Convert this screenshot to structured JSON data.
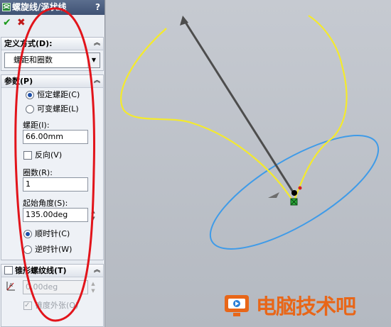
{
  "panel": {
    "title": "螺旋线/涡状线",
    "help": "?",
    "ok_icon": "check-icon",
    "cancel_icon": "close-icon"
  },
  "definition": {
    "header": "定义方式(D):",
    "selected": "螺距和圈数"
  },
  "params": {
    "header": "参数(P)",
    "pitch_mode_constant": "恒定螺距(C)",
    "pitch_mode_variable": "可变螺距(L)",
    "pitch_label": "螺距(I):",
    "pitch_value": "66.00mm",
    "reverse_label": "反向(V)",
    "turns_label": "圈数(R):",
    "turns_value": "1",
    "start_angle_label": "起始角度(S):",
    "start_angle_value": "135.00deg",
    "clockwise": "顺时针(C)",
    "counterclockwise": "逆时针(W)"
  },
  "taper": {
    "header": "锥形螺纹线(T)",
    "angle_value": "0.00deg",
    "outward_label": "锥度外张(O)"
  },
  "watermark": {
    "text": "电脑技术吧"
  },
  "colors": {
    "helix_upper": "#f4ea2c",
    "helix_lower": "#3f9be8",
    "axis": "#4d4d4d",
    "annotation": "#e2141b",
    "watermark": "#e86618"
  }
}
